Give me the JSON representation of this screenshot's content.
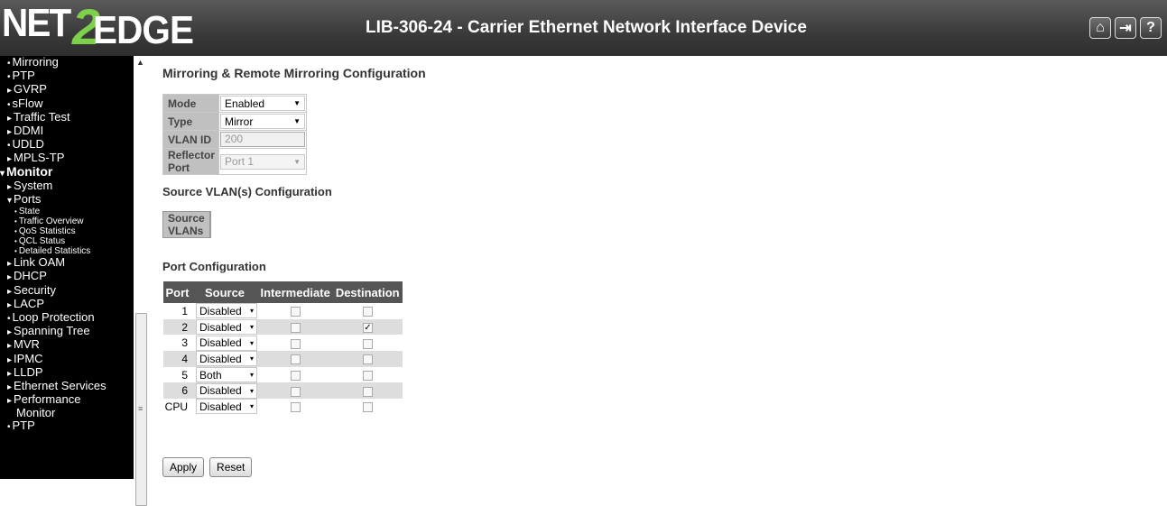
{
  "header": {
    "logo": {
      "part1": "NET",
      "part2": "2",
      "part3": "EDGE"
    },
    "title": "LIB-306-24 - Carrier Ethernet Network Interface Device",
    "buttons": [
      {
        "name": "home-icon",
        "glyph": "⌂"
      },
      {
        "name": "logout-icon",
        "glyph": "⇥"
      },
      {
        "name": "help-icon",
        "glyph": "?"
      }
    ]
  },
  "sidebar": {
    "items": [
      {
        "label": "Mirroring",
        "kind": "bul",
        "level": "l1"
      },
      {
        "label": "PTP",
        "kind": "bul",
        "level": "l1"
      },
      {
        "label": "GVRP",
        "kind": "arr",
        "level": "l1"
      },
      {
        "label": "sFlow",
        "kind": "bul",
        "level": "l1"
      },
      {
        "label": "Traffic Test",
        "kind": "arr",
        "level": "l1"
      },
      {
        "label": "DDMI",
        "kind": "arr",
        "level": "l1"
      },
      {
        "label": "UDLD",
        "kind": "bul",
        "level": "l1"
      },
      {
        "label": "MPLS-TP",
        "kind": "arr",
        "level": "l1"
      },
      {
        "label": "Monitor",
        "kind": "dn",
        "level": "sec"
      },
      {
        "label": "System",
        "kind": "arr",
        "level": "l1"
      },
      {
        "label": "Ports",
        "kind": "dn",
        "level": "l1"
      },
      {
        "label": "State",
        "kind": "sub",
        "level": "sub"
      },
      {
        "label": "Traffic Overview",
        "kind": "sub",
        "level": "sub"
      },
      {
        "label": "QoS Statistics",
        "kind": "sub",
        "level": "sub"
      },
      {
        "label": "QCL Status",
        "kind": "sub",
        "level": "sub"
      },
      {
        "label": "Detailed Statistics",
        "kind": "sub",
        "level": "sub"
      },
      {
        "label": "Link OAM",
        "kind": "arr",
        "level": "l1"
      },
      {
        "label": "DHCP",
        "kind": "arr",
        "level": "l1"
      },
      {
        "label": "Security",
        "kind": "arr",
        "level": "l1"
      },
      {
        "label": "LACP",
        "kind": "arr",
        "level": "l1"
      },
      {
        "label": "Loop Protection",
        "kind": "bul",
        "level": "l1"
      },
      {
        "label": "Spanning Tree",
        "kind": "arr",
        "level": "l1"
      },
      {
        "label": "MVR",
        "kind": "arr",
        "level": "l1"
      },
      {
        "label": "IPMC",
        "kind": "arr",
        "level": "l1"
      },
      {
        "label": "LLDP",
        "kind": "arr",
        "level": "l1"
      },
      {
        "label": "Ethernet Services",
        "kind": "arr",
        "level": "l1"
      },
      {
        "label": "Performance",
        "kind": "arr",
        "level": "l1"
      },
      {
        "label": "Monitor",
        "kind": "none",
        "level": "l1b"
      },
      {
        "label": "PTP",
        "kind": "bul",
        "level": "l1"
      }
    ]
  },
  "main": {
    "title": "Mirroring & Remote Mirroring Configuration",
    "config": {
      "mode_label": "Mode",
      "mode_value": "Enabled",
      "type_label": "Type",
      "type_value": "Mirror",
      "vlan_label": "VLAN ID",
      "vlan_value": "200",
      "reflector_label": "Reflector Port",
      "reflector_value": "Port 1"
    },
    "source_title": "Source VLAN(s) Configuration",
    "source_label": "Source VLANs",
    "source_value": "",
    "port_title": "Port Configuration",
    "port_headers": [
      "Port",
      "Source",
      "Intermediate",
      "Destination"
    ],
    "ports": [
      {
        "port": "1",
        "source": "Disabled",
        "intermediate": false,
        "destination": false
      },
      {
        "port": "2",
        "source": "Disabled",
        "intermediate": false,
        "destination": true
      },
      {
        "port": "3",
        "source": "Disabled",
        "intermediate": false,
        "destination": false
      },
      {
        "port": "4",
        "source": "Disabled",
        "intermediate": false,
        "destination": false
      },
      {
        "port": "5",
        "source": "Both",
        "intermediate": false,
        "destination": false
      },
      {
        "port": "6",
        "source": "Disabled",
        "intermediate": false,
        "destination": false
      },
      {
        "port": "CPU",
        "source": "Disabled",
        "intermediate": false,
        "destination": false
      }
    ],
    "apply_label": "Apply",
    "reset_label": "Reset"
  }
}
